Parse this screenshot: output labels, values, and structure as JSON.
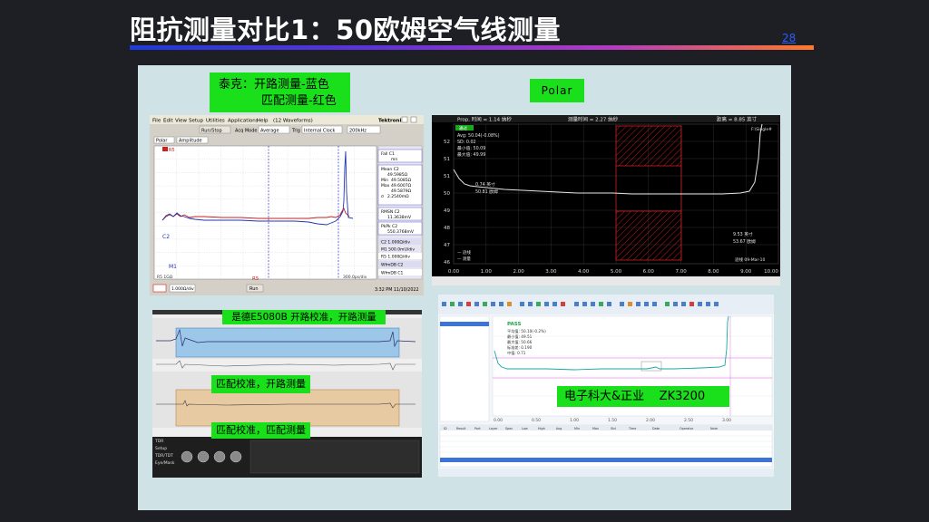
{
  "slide": {
    "title": "阻抗测量对比1：50欧姆空气线测量",
    "page_number": "28"
  },
  "tek": {
    "label_line1": "泰克：开路测量-蓝色",
    "label_line2": "匹配测量-红色",
    "menu": [
      "File",
      "Edit",
      "View",
      "Setup",
      "Utilities",
      "Applications",
      "Help"
    ],
    "window_title": "(12 Waveforms)",
    "brand": "Tektronix",
    "toolbar": {
      "run_stop": "Run/Stop",
      "acq_mode": "Acq Mode",
      "acq_value": "Average",
      "trig": "Trig",
      "trig_value": "Internal Clock",
      "freq": "200kHz"
    },
    "selects": {
      "mode": "Polar",
      "amplitude": "Amplitude"
    },
    "trace_labels": {
      "r5": "R5",
      "c2": "C2",
      "m1": "M1",
      "r5_bottom": "R5"
    },
    "axis_bottom": {
      "left": "R5 1GΩ",
      "right": "300.0ps/div"
    },
    "meas": {
      "fall_header": "Fall   C1",
      "fall_unit": "mn",
      "mean_label": "Mean  C2",
      "mean_value": "49.5985Ω",
      "min_label": "Min",
      "min_value": "49.5085Ω",
      "max_label": "Max",
      "max_value": "49.6007Ω",
      "pp_label": "",
      "pp_value": "49.5879Ω",
      "sigma_label": "σ",
      "sigma_value": "2.2540mΩ",
      "rmsn_label": "RMSN  C2",
      "rmsn_value": "11.3638mV",
      "pkpk_label": "PkPk  C2",
      "pkpk_value": "550.3768mV",
      "c2_scale": "C2 1.000Ω/div",
      "m1_scale": "M1 500.0mU/div",
      "r5_scale": "R5 1.000Ω/div",
      "wfmdb_c2": "WfmDB C2",
      "wfmdb_c1": "WfmDB C1"
    },
    "status": {
      "time_div": "1.000Ω/div",
      "run": "Run",
      "timestamp": "3:32 PM 11/10/2022"
    }
  },
  "polar": {
    "label": "Polar",
    "header_left": "Prop. 时间 = 1.14 纳秒",
    "header_mid": "测量时间 = 2.27 纳秒",
    "header_right": "距离 = 8.85 英寸",
    "pass_badge": "通过",
    "stats": [
      "Avg: 50.04(-0.08%)",
      "SD: 0.02",
      "最小值: 50.09",
      "最大值: 49.99"
    ],
    "cursor_left": [
      "0.74 英寸",
      "50.81 欧姆"
    ],
    "cursor_right": [
      "9.53 英寸",
      "53.67 欧姆"
    ],
    "file_label": "F:\\Single#",
    "legend": [
      "— 迹线",
      "— 测量"
    ],
    "date_label": "迹线 09-Mar-10",
    "y_ticks": [
      "52",
      "51",
      "51",
      "50",
      "49",
      "48",
      "47",
      "46"
    ],
    "x_ticks": [
      "0.00",
      "1.00",
      "2.00",
      "3.00",
      "4.00",
      "5.00",
      "6.00",
      "7.00",
      "8.00",
      "9.00",
      "10.00"
    ]
  },
  "keysight": {
    "label": "是德E5080B 开路校准，开路测量",
    "label_mid": "匹配校准，开路测量",
    "label_bottom": "匹配校准，匹配测量",
    "side_labels": [
      "TDR",
      "Setup",
      "TDR/TDT",
      "Eye/Mask"
    ]
  },
  "zk": {
    "label": "电子科大&正业    ZK3200",
    "pass": "PASS",
    "stats": [
      "平均值:  50.10(-0.2%)",
      "最小值:  49.51",
      "最大值:  50.66",
      "标准差:  0.190",
      "中值:  0.71"
    ],
    "x_ticks": [
      "0.00",
      "0.50",
      "1.00",
      "1.50",
      "2.00",
      "2.50",
      "3.00"
    ],
    "table_headers": [
      "ID",
      "Result",
      "Port",
      "Layer",
      "Spec",
      "Low",
      "High",
      "Avg",
      "Min",
      "Max",
      "Std",
      "Time",
      "Date",
      "Operator",
      "Note"
    ]
  },
  "colors": {
    "green_label": "#19e01b",
    "open_trace": "#2236b0",
    "match_trace": "#c62020",
    "polar_trace": "#e6e6e6",
    "zk_trace": "#1aa6a6"
  }
}
